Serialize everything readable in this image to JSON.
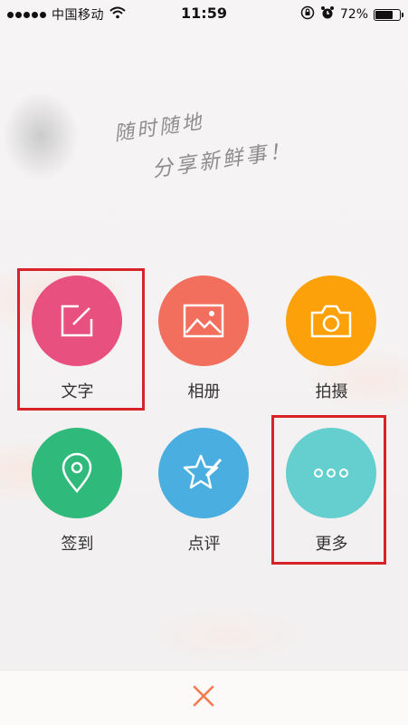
{
  "status_bar": {
    "carrier": "中国移动",
    "time": "11:59",
    "battery_percent_text": "72%",
    "battery_level": 0.72
  },
  "slogan": {
    "line1": "随时随地",
    "line2": "分享新鲜事！"
  },
  "actions": [
    {
      "key": "text",
      "label": "文字",
      "color": "#e8507f",
      "icon": "edit-icon"
    },
    {
      "key": "album",
      "label": "相册",
      "color": "#f26e5d",
      "icon": "image-icon"
    },
    {
      "key": "camera",
      "label": "拍摄",
      "color": "#fda10b",
      "icon": "camera-icon"
    },
    {
      "key": "checkin",
      "label": "签到",
      "color": "#2fba7c",
      "icon": "location-pin-icon"
    },
    {
      "key": "review",
      "label": "点评",
      "color": "#4aaee1",
      "icon": "star-pen-icon"
    },
    {
      "key": "more",
      "label": "更多",
      "color": "#64cfce",
      "icon": "more-dots-icon"
    }
  ],
  "highlight_color": "#d8232a",
  "close_icon_color": "#f47a50"
}
